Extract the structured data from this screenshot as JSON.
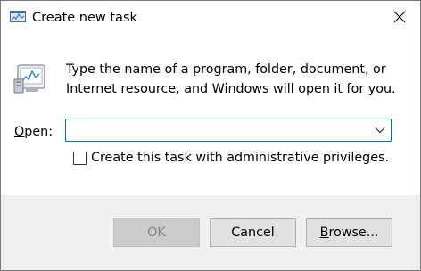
{
  "window": {
    "title": "Create new task",
    "title_icon": "task-manager-icon",
    "close_icon": "close-icon"
  },
  "content": {
    "app_icon": "run-program-icon",
    "description": "Type the name of a program, folder, document, or Internet resource, and Windows will open it for you.",
    "open_label_accel": "O",
    "open_label_rest": "pen:",
    "open_value": "",
    "open_placeholder": "",
    "dropdown_icon": "chevron-down-icon",
    "admin_checkbox_label": "Create this task with administrative privileges.",
    "admin_checked": false
  },
  "buttons": {
    "ok": "OK",
    "ok_enabled": false,
    "cancel": "Cancel",
    "browse_accel": "B",
    "browse_rest": "rowse..."
  },
  "colors": {
    "accent": "#0078d7",
    "footer_bg": "#f0f0f0",
    "button_bg": "#e1e1e1",
    "disabled_text": "#838383"
  }
}
